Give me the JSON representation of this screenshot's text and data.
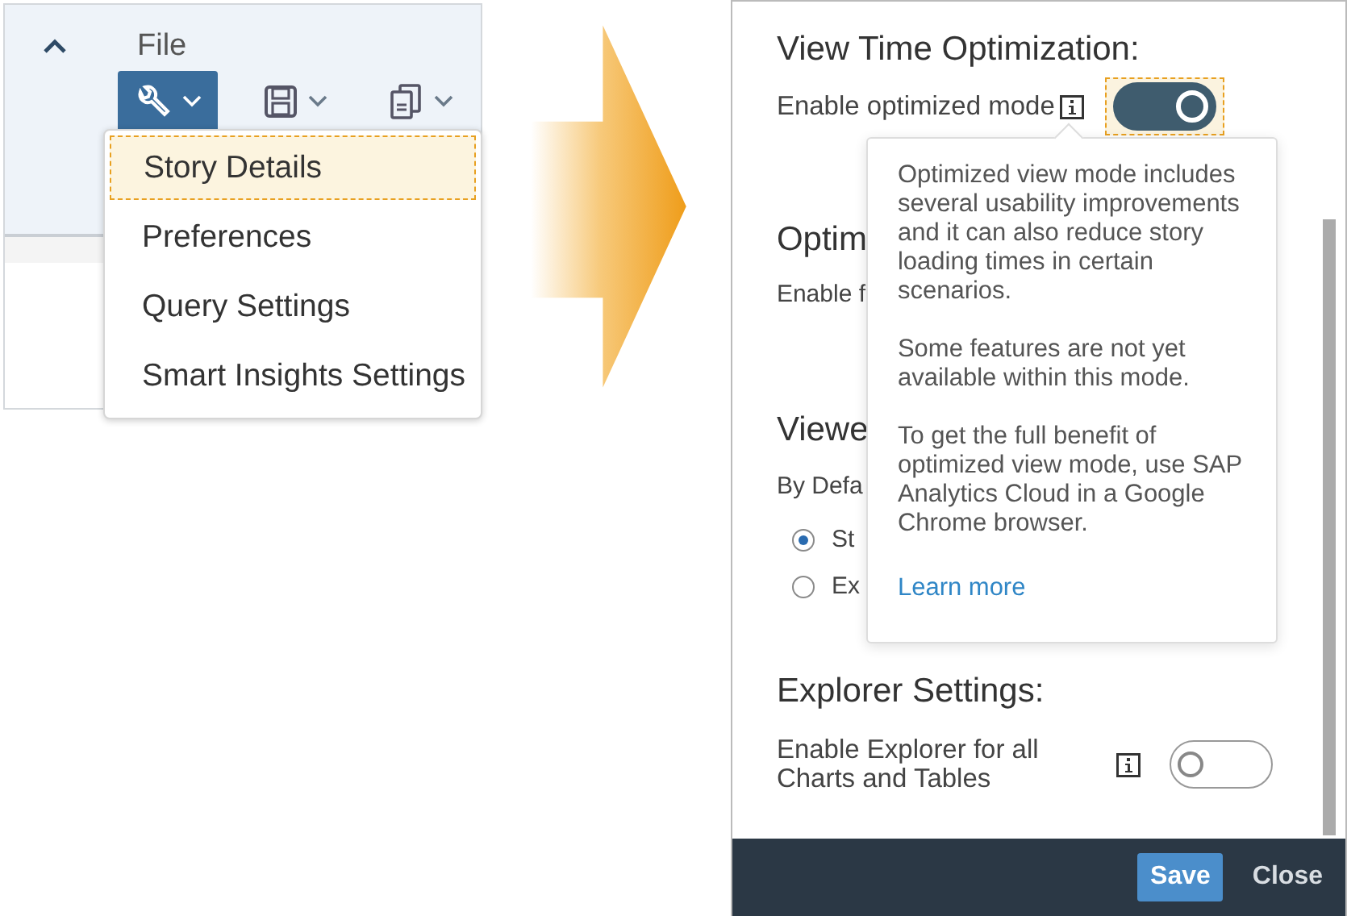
{
  "file_panel": {
    "section_label": "File",
    "toolbar": [
      {
        "kind": "tools",
        "selected": true
      },
      {
        "kind": "save",
        "selected": false
      },
      {
        "kind": "copy",
        "selected": false
      }
    ],
    "menu": [
      {
        "label": "Story Details",
        "selected": true
      },
      {
        "label": "Preferences",
        "selected": false
      },
      {
        "label": "Query Settings",
        "selected": false
      },
      {
        "label": "Smart Insights Settings",
        "selected": false
      }
    ]
  },
  "dialog": {
    "sections": [
      {
        "kind": "toggle",
        "title": "View Time Optimization:",
        "label": "Enable optimized mode",
        "on": true,
        "focused": true
      },
      {
        "kind": "partial",
        "title": "Optim",
        "label": "Enable f"
      },
      {
        "kind": "radios",
        "title": "Viewe",
        "label": "By Defa",
        "options": [
          {
            "label": "St",
            "selected": true
          },
          {
            "label": "Ex",
            "selected": false
          }
        ]
      },
      {
        "kind": "toggle",
        "title": "Explorer Settings:",
        "label": "Enable Explorer for all Charts and Tables",
        "on": false,
        "focused": false
      }
    ],
    "tooltip": {
      "paragraphs": [
        "Optimized view mode includes several usability improvements and it can also reduce story loading times in certain scenarios.",
        "Some features are not yet available within this mode.",
        "To get the full benefit of optimized view mode, use SAP Analytics Cloud in a Google Chrome browser."
      ],
      "link": "Learn more"
    },
    "buttons": [
      {
        "label": "Save",
        "kind": "primary"
      },
      {
        "label": "Close",
        "kind": "plain"
      }
    ]
  }
}
